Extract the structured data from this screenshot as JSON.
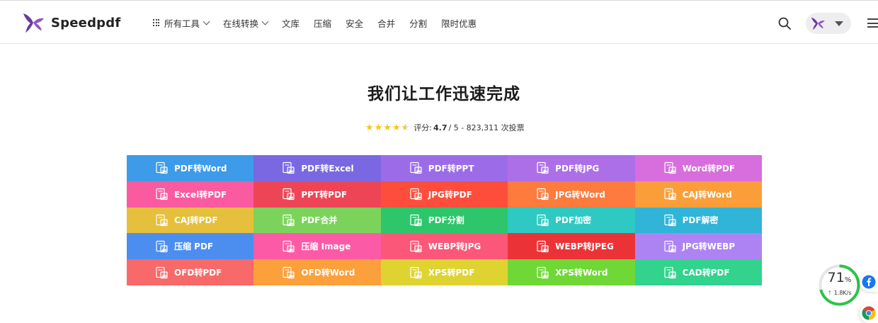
{
  "brand": {
    "name": "Speedpdf",
    "logo_icon": "butterfly-logo-icon",
    "color": "#6a3aa0"
  },
  "nav": {
    "all_tools": "所有工具",
    "items": [
      {
        "label": "在线转换",
        "dropdown": true
      },
      {
        "label": "文库",
        "dropdown": false
      },
      {
        "label": "压缩",
        "dropdown": false
      },
      {
        "label": "安全",
        "dropdown": false
      },
      {
        "label": "合并",
        "dropdown": false
      },
      {
        "label": "分割",
        "dropdown": false
      },
      {
        "label": "限时优惠",
        "dropdown": false
      }
    ]
  },
  "hero": {
    "title": "我们让工作迅速完成",
    "rating_label": "评分:",
    "rating_value": "4.7",
    "rating_suffix": "/ 5 - 823,311 次投票",
    "stars": 4.5,
    "star_color": "#f5c518"
  },
  "tools": [
    {
      "label": "PDF转Word",
      "color": "#3d9be9",
      "icon": "document-image-icon"
    },
    {
      "label": "PDF转Excel",
      "color": "#7a68e2",
      "icon": "document-image-icon"
    },
    {
      "label": "PDF转PPT",
      "color": "#9c6ce8",
      "icon": "document-image-icon"
    },
    {
      "label": "PDF转JPG",
      "color": "#ad6fe7",
      "icon": "document-image-icon"
    },
    {
      "label": "Word转PDF",
      "color": "#d86ddd",
      "icon": "document-lines-icon"
    },
    {
      "label": "Excel转PDF",
      "color": "#fa5aa0",
      "icon": "spreadsheet-icon"
    },
    {
      "label": "PPT转PDF",
      "color": "#ee4556",
      "icon": "presentation-icon"
    },
    {
      "label": "JPG转PDF",
      "color": "#ff4d3c",
      "icon": "image-to-pdf-icon"
    },
    {
      "label": "JPG转Word",
      "color": "#fd7b3d",
      "icon": "image-to-word-icon"
    },
    {
      "label": "CAJ转Word",
      "color": "#fb9e3a",
      "icon": "caj-icon"
    },
    {
      "label": "CAJ转PDF",
      "color": "#e6bf3c",
      "icon": "caj-icon"
    },
    {
      "label": "PDF合并",
      "color": "#7bd35b",
      "icon": "merge-icon"
    },
    {
      "label": "PDF分割",
      "color": "#2dc66b",
      "icon": "split-icon"
    },
    {
      "label": "PDF加密",
      "color": "#2ec9c2",
      "icon": "lock-icon"
    },
    {
      "label": "PDF解密",
      "color": "#30b4d8",
      "icon": "unlock-icon"
    },
    {
      "label": "压缩 PDF",
      "color": "#4b8ef0",
      "icon": "compress-icon"
    },
    {
      "label": "压缩 Image",
      "color": "#fc5aa6",
      "icon": "compress-image-icon"
    },
    {
      "label": "WEBP转JPG",
      "color": "#fb5779",
      "icon": "image-convert-icon"
    },
    {
      "label": "WEBP转JPEG",
      "color": "#eb3337",
      "icon": "image-convert-icon"
    },
    {
      "label": "JPG转WEBP",
      "color": "#ad83f4",
      "icon": "image-convert-icon"
    },
    {
      "label": "OFD转PDF",
      "color": "#f8696a",
      "icon": "ofd-icon"
    },
    {
      "label": "OFD转Word",
      "color": "#fca03c",
      "icon": "ofd-icon"
    },
    {
      "label": "XPS转PDF",
      "color": "#dfd332",
      "icon": "xps-icon"
    },
    {
      "label": "XPS转Word",
      "color": "#6fd836",
      "icon": "xps-icon"
    },
    {
      "label": "CAD转PDF",
      "color": "#31d38d",
      "icon": "cad-icon"
    }
  ],
  "speed_widget": {
    "percent": "71",
    "percent_unit": "%",
    "rate": "1.8K/s",
    "ring_fill": 0.71,
    "ring_color": "#2bc449"
  },
  "side_buttons": [
    {
      "icon": "facebook-icon",
      "color": "#1877f2"
    },
    {
      "icon": "chrome-icon"
    }
  ]
}
